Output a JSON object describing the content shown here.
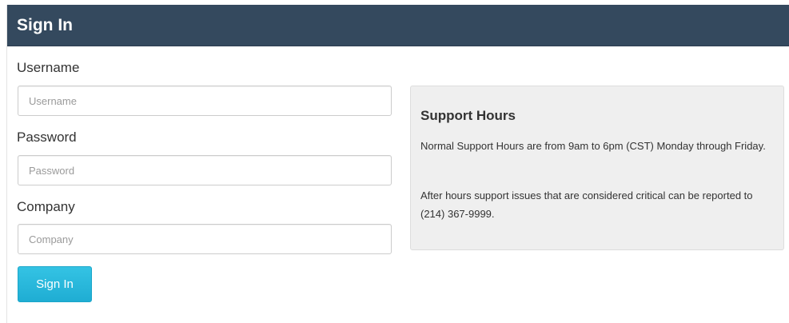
{
  "header": {
    "title": "Sign In"
  },
  "form": {
    "username": {
      "label": "Username",
      "placeholder": "Username",
      "value": ""
    },
    "password": {
      "label": "Password",
      "placeholder": "Password",
      "value": ""
    },
    "company": {
      "label": "Company",
      "placeholder": "Company",
      "value": ""
    },
    "submit_label": "Sign In"
  },
  "support": {
    "title": "Support Hours",
    "paragraph_1": "Normal Support Hours are from 9am to 6pm (CST) Monday through Friday.",
    "paragraph_2": "After hours support issues that are considered critical can be reported to (214) 367-9999."
  },
  "colors": {
    "header_background": "#34495e",
    "button_background": "#2bb8dc",
    "support_box_background": "#efefef"
  }
}
